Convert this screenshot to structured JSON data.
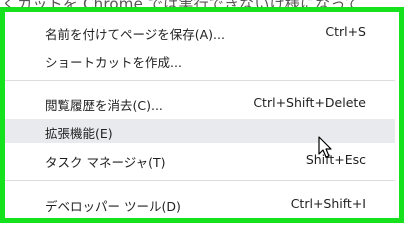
{
  "background_text": "くカットを Chrome では実行できないけ様になって",
  "menu": {
    "items": [
      {
        "label": "名前を付けてページを保存(A)...",
        "shortcut": "Ctrl+S"
      },
      {
        "label": "ショートカットを作成...",
        "shortcut": ""
      },
      {
        "label": "閲覧履歴を消去(C)...",
        "shortcut": "Ctrl+Shift+Delete"
      },
      {
        "label": "拡張機能(E)",
        "shortcut": ""
      },
      {
        "label": "タスク マネージャ(T)",
        "shortcut": "Shift+Esc"
      },
      {
        "label": "デベロッパー ツール(D)",
        "shortcut": "Ctrl+Shift+I"
      }
    ],
    "hovered_item": "拡張機能(E)"
  },
  "colors": {
    "highlight_border": "#15e21c",
    "hover_background": "#e8eaee",
    "text": "#1f1f1f",
    "separator": "#dcdcdc"
  },
  "cursor": "mouse-pointer-icon"
}
